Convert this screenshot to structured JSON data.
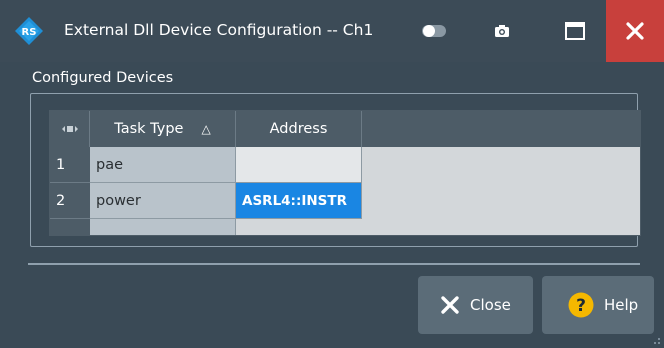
{
  "window": {
    "title": "External Dll Device Configuration -- Ch1"
  },
  "colors": {
    "titlebar_bg": "#3c4b57",
    "close_button_bg": "#c8403c",
    "selected_cell_bg": "#1a86e3",
    "button_bg": "#5b6c78",
    "help_icon_bg": "#f5b800"
  },
  "icons": {
    "app_logo": "rohde-schwarz-logo-icon",
    "toggle": "toggle-switch-icon",
    "camera": "camera-icon",
    "maximize": "maximize-icon",
    "close": "close-icon",
    "column_select": "column-select-icon",
    "sort": "sort-ascending-icon",
    "close_button": "x-icon",
    "help_button": "question-mark-icon"
  },
  "group": {
    "title": "Configured Devices"
  },
  "table": {
    "columns": [
      {
        "label": "Task Type",
        "sort": "ascending"
      },
      {
        "label": "Address"
      }
    ],
    "sort_glyph": "△",
    "rows": [
      {
        "index": "1",
        "task_type": "pae",
        "address": ""
      },
      {
        "index": "2",
        "task_type": "power",
        "address": "ASRL4::INSTR",
        "selected": true
      }
    ]
  },
  "buttons": {
    "close_label": "Close",
    "help_label": "Help"
  }
}
